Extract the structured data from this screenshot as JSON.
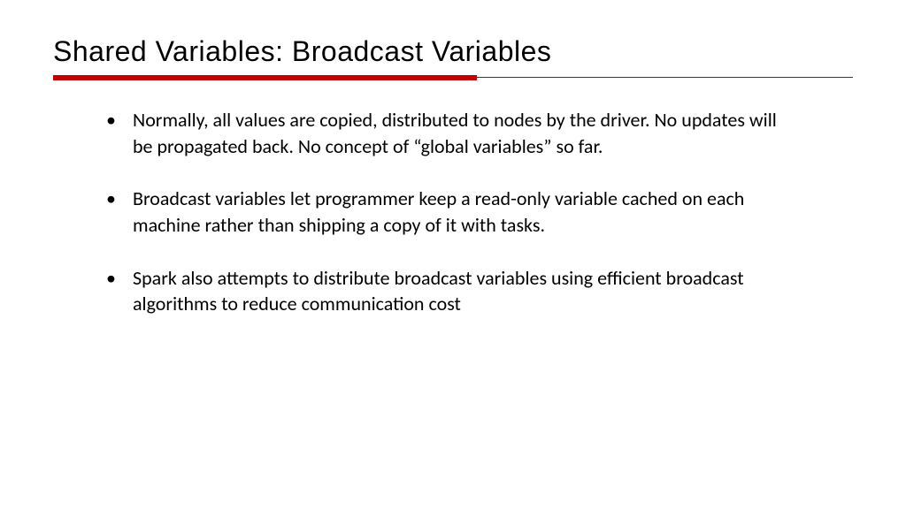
{
  "title": "Shared Variables: Broadcast Variables",
  "bullets": [
    "Normally, all values are copied, distributed to nodes by the driver. No updates will be propagated back. No concept of “global variables” so far.",
    "Broadcast variables let programmer keep a read-only variable cached on each machine rather than shipping a copy of it with tasks.",
    "Spark also attempts to distribute broadcast variables using efficient broadcast algorithms to reduce communication cost"
  ]
}
